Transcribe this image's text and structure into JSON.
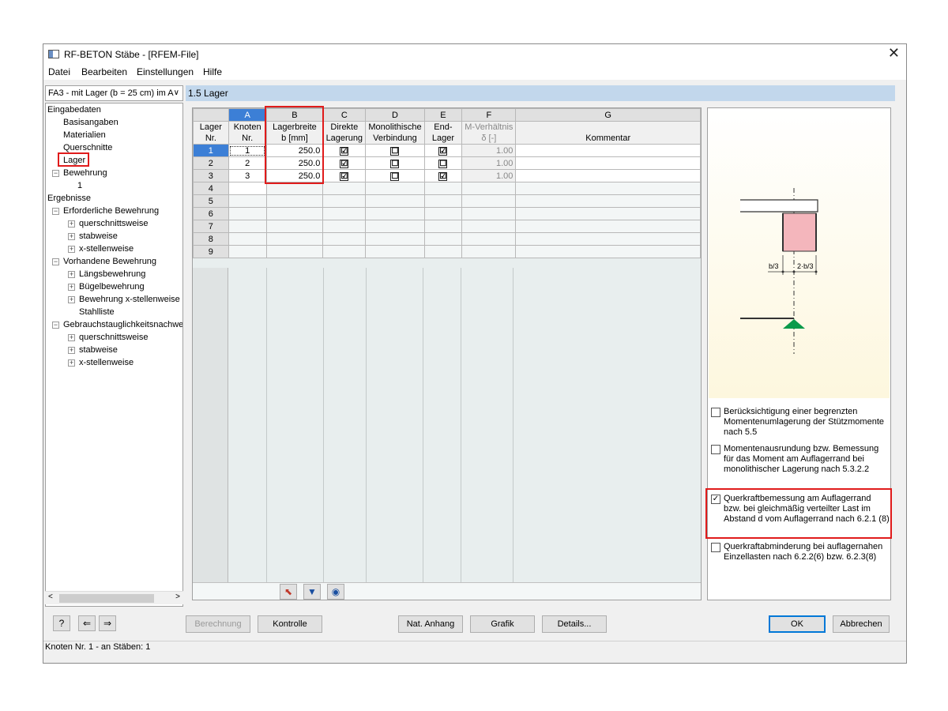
{
  "window": {
    "title": "RF-BETON Stäbe - [RFEM-File]",
    "close": "✕"
  },
  "menu": [
    "Datei",
    "Bearbeiten",
    "Einstellungen",
    "Hilfe"
  ],
  "case_select": {
    "value": "FA3 - mit Lager (b = 25 cm) im A"
  },
  "tree": {
    "eingabe": "Eingabedaten",
    "basis": "Basisangaben",
    "material": "Materialien",
    "querschnitte": "Querschnitte",
    "lager": "Lager",
    "bewehrung": "Bewehrung",
    "bewehrung_1": "1",
    "ergebnisse": "Ergebnisse",
    "erf": "Erforderliche Bewehrung",
    "erf_q": "querschnittsweise",
    "erf_s": "stabweise",
    "erf_x": "x-stellenweise",
    "vorh": "Vorhandene Bewehrung",
    "vorh_l": "Längsbewehrung",
    "vorh_b": "Bügelbewehrung",
    "vorh_x": "Bewehrung x-stellenweise",
    "vorh_st": "Stahlliste",
    "gzt": "Gebrauchstauglichkeitsnachwei",
    "gzt_q": "querschnittsweise",
    "gzt_s": "stabweise",
    "gzt_x": "x-stellenweise"
  },
  "panel_title": "1.5 Lager",
  "table": {
    "col_letters": [
      "A",
      "B",
      "C",
      "D",
      "E",
      "F",
      "G"
    ],
    "headers": {
      "nr": [
        "Lager",
        "Nr."
      ],
      "A": [
        "Knoten",
        "Nr."
      ],
      "B": [
        "Lagerbreite",
        "b [mm]"
      ],
      "C": [
        "Direkte",
        "Lagerung"
      ],
      "D": [
        "Monolithische",
        "Verbindung"
      ],
      "E": [
        "End-",
        "Lager"
      ],
      "F": [
        "M-Verhältnis",
        "δ [-]"
      ],
      "G": [
        "",
        "Kommentar"
      ]
    },
    "rows": [
      {
        "nr": "1",
        "knoten": "1",
        "breite": "250.0",
        "direkt": "☑",
        "mono": "☐",
        "end": "☑",
        "ratio": "1.00"
      },
      {
        "nr": "2",
        "knoten": "2",
        "breite": "250.0",
        "direkt": "☑",
        "mono": "☐",
        "end": "☐",
        "ratio": "1.00"
      },
      {
        "nr": "3",
        "knoten": "3",
        "breite": "250.0",
        "direkt": "☑",
        "mono": "☐",
        "end": "☑",
        "ratio": "1.00"
      }
    ],
    "empty_rows": [
      "4",
      "5",
      "6",
      "7",
      "8",
      "9"
    ]
  },
  "graphic": {
    "label_b3": "b/3",
    "label_2b3": "2·b/3"
  },
  "options": [
    {
      "checked": false,
      "text": "Berücksichtigung einer begrenzten Momentenumlagerung der Stützmomente nach 5.5"
    },
    {
      "checked": false,
      "text": "Momentenausrundung bzw. Bemessung für das Moment am Auflagerrand bei monolithischer Lagerung nach 5.3.2.2"
    },
    {
      "checked": true,
      "text": "Querkraftbemessung am Auflagerrand bzw. bei gleichmäßig verteilter Last im Abstand d vom Auflagerrand nach 6.2.1 (8)"
    },
    {
      "checked": false,
      "text": "Querkraftabminderung bei auflagernahen Einzellasten nach 6.2.2(6) bzw. 6.2.3(8)"
    }
  ],
  "buttons": {
    "berechnung": "Berechnung",
    "kontrolle": "Kontrolle",
    "anhang": "Nat. Anhang",
    "grafik": "Grafik",
    "details": "Details...",
    "ok": "OK",
    "abbrechen": "Abbrechen"
  },
  "status": "Knoten Nr. 1 - an Stäben: 1"
}
